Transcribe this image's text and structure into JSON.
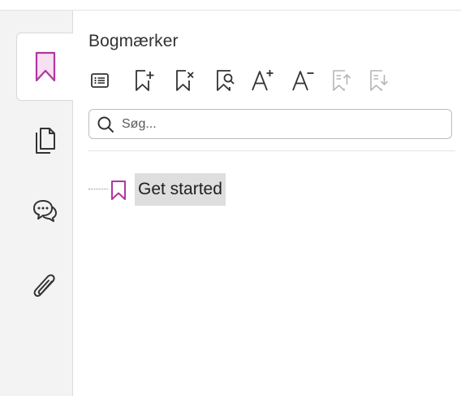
{
  "panel": {
    "title": "Bogmærker"
  },
  "rail": {
    "tabs": [
      {
        "icon": "bookmark-icon",
        "active": true
      },
      {
        "icon": "pages-icon",
        "active": false
      },
      {
        "icon": "comments-icon",
        "active": false
      },
      {
        "icon": "attachment-icon",
        "active": false
      }
    ]
  },
  "toolbar": {
    "tools": [
      {
        "icon": "options-list-icon",
        "enabled": true
      },
      {
        "icon": "add-bookmark-icon",
        "enabled": true
      },
      {
        "icon": "delete-bookmark-icon",
        "enabled": true
      },
      {
        "icon": "find-bookmark-icon",
        "enabled": true
      },
      {
        "icon": "increase-text-size-icon",
        "enabled": true
      },
      {
        "icon": "decrease-text-size-icon",
        "enabled": true
      },
      {
        "icon": "move-up-icon",
        "enabled": false
      },
      {
        "icon": "move-down-icon",
        "enabled": false
      }
    ]
  },
  "search": {
    "value": "",
    "placeholder": "Søg..."
  },
  "bookmarks": [
    {
      "label": "Get started",
      "selected": true
    }
  ],
  "colors": {
    "accent": "#b1369f",
    "rail_bg": "#f3f3f3",
    "icon": "#333333",
    "icon_disabled": "#b5b5b5",
    "selection": "#dedede"
  }
}
